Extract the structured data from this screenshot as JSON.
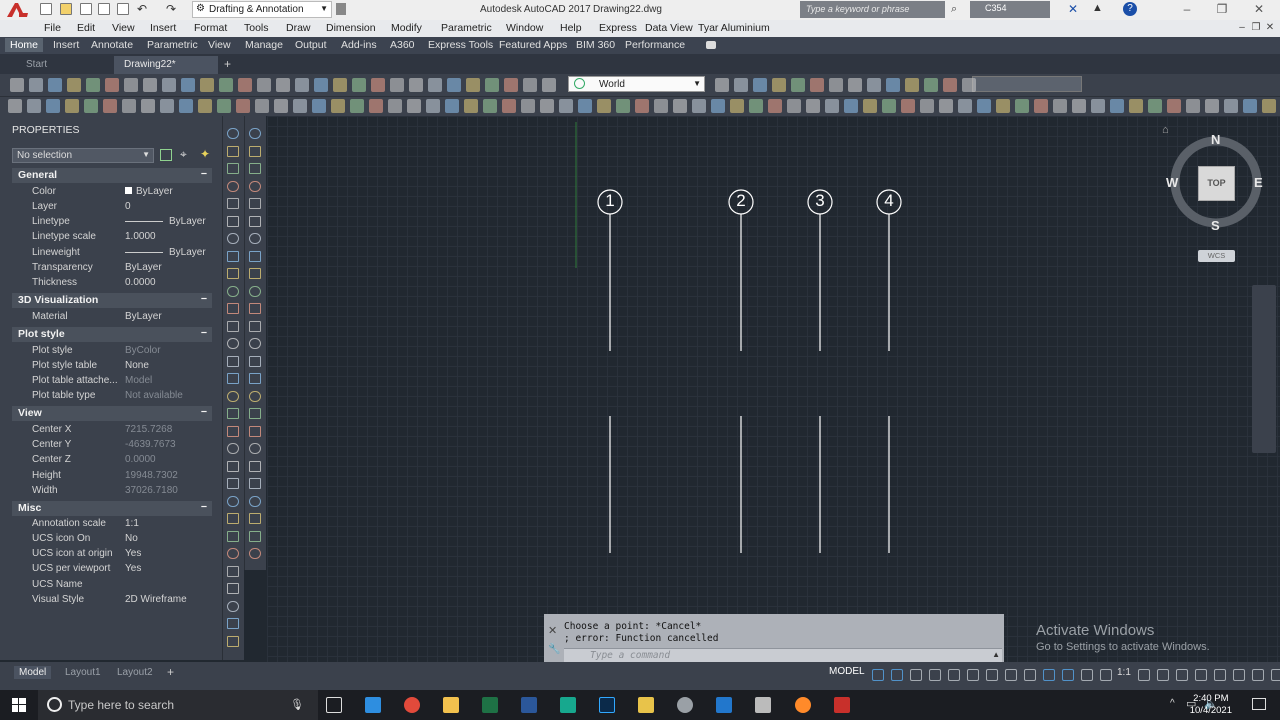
{
  "title_bar": {
    "workspace": "Drafting & Annotation",
    "app_title": "Autodesk AutoCAD 2017",
    "file_name": "Drawing22.dwg",
    "search_placeholder": "Type a keyword or phrase",
    "user": "C354"
  },
  "menu_bar": [
    "File",
    "Edit",
    "View",
    "Insert",
    "Format",
    "Tools",
    "Draw",
    "Dimension",
    "Modify",
    "Parametric",
    "Window",
    "Help",
    "Express",
    "Data View",
    "Tyar Aluminium"
  ],
  "ribbon_tabs": [
    "Home",
    "Insert",
    "Annotate",
    "Parametric",
    "View",
    "Manage",
    "Output",
    "Add-ins",
    "A360",
    "Express Tools",
    "Featured Apps",
    "BIM 360",
    "Performance"
  ],
  "file_tabs": {
    "start": "Start",
    "drawing": "Drawing22*",
    "add": "+"
  },
  "toolbar": {
    "ucs_select": "World"
  },
  "properties": {
    "title": "PROPERTIES",
    "selection": "No selection",
    "sections": {
      "general": {
        "title": "General",
        "collapse": "−",
        "rows": [
          {
            "label": "Color",
            "value": "ByLayer"
          },
          {
            "label": "Layer",
            "value": "0"
          },
          {
            "label": "Linetype",
            "value": "ByLayer"
          },
          {
            "label": "Linetype scale",
            "value": "1.0000"
          },
          {
            "label": "Lineweight",
            "value": "ByLayer"
          },
          {
            "label": "Transparency",
            "value": "ByLayer"
          },
          {
            "label": "Thickness",
            "value": "0.0000"
          }
        ]
      },
      "viz": {
        "title": "3D Visualization",
        "collapse": "−",
        "rows": [
          {
            "label": "Material",
            "value": "ByLayer"
          }
        ]
      },
      "plot": {
        "title": "Plot style",
        "collapse": "−",
        "rows": [
          {
            "label": "Plot style",
            "value": "ByColor"
          },
          {
            "label": "Plot style table",
            "value": "None"
          },
          {
            "label": "Plot table attache...",
            "value": "Model"
          },
          {
            "label": "Plot table type",
            "value": "Not available"
          }
        ]
      },
      "view": {
        "title": "View",
        "collapse": "−",
        "rows": [
          {
            "label": "Center X",
            "value": "7215.7268"
          },
          {
            "label": "Center Y",
            "value": "-4639.7673"
          },
          {
            "label": "Center Z",
            "value": "0.0000"
          },
          {
            "label": "Height",
            "value": "19948.7302"
          },
          {
            "label": "Width",
            "value": "37026.7180"
          }
        ]
      },
      "misc": {
        "title": "Misc",
        "collapse": "−",
        "rows": [
          {
            "label": "Annotation scale",
            "value": "1:1"
          },
          {
            "label": "UCS icon On",
            "value": "No"
          },
          {
            "label": "UCS icon at origin",
            "value": "Yes"
          },
          {
            "label": "UCS per viewport",
            "value": "Yes"
          },
          {
            "label": "UCS Name",
            "value": ""
          },
          {
            "label": "Visual Style",
            "value": "2D Wireframe"
          }
        ]
      }
    }
  },
  "drawing": {
    "grid_bubbles": [
      "1",
      "2",
      "3",
      "4"
    ]
  },
  "viewcube": {
    "north": "N",
    "south": "S",
    "east": "E",
    "west": "W",
    "face": "TOP",
    "wcs": "WCS"
  },
  "command_line": {
    "history": [
      "Choose a point: *Cancel*",
      "; error: Function cancelled"
    ],
    "placeholder": "Type a command"
  },
  "watermark": {
    "line1": "Activate Windows",
    "line2": "Go to Settings to activate Windows."
  },
  "status_bar": {
    "layouts": [
      "Model",
      "Layout1",
      "Layout2"
    ],
    "add": "+",
    "model_button": "MODEL",
    "scale": "1:1"
  },
  "taskbar": {
    "search_placeholder": "Type here to search",
    "time": "2:40 PM",
    "date": "10/4/2021"
  },
  "colors": {
    "canvas": "#212830",
    "panel": "#3b414c",
    "accent_red": "#c8302b",
    "grid_line": "#ffffff"
  }
}
